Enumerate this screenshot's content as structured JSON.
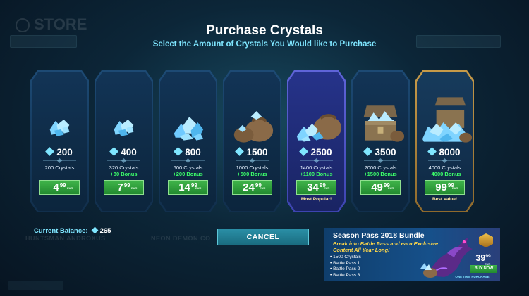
{
  "title": "Purchase Crystals",
  "subtitle": "Select the Amount of Crystals You Would like to Purchase",
  "background": {
    "store_label": "STORE",
    "name_left": "HUNTSMAN ANDROXUS",
    "name_center": "NEON DEMON CO"
  },
  "packs": [
    {
      "amount": "200",
      "crystals": "200 Crystals",
      "bonus": "",
      "price_main": "4",
      "price_cents": "99",
      "currency": "EUR",
      "tag": "",
      "variant": "normal",
      "art": "crystals-small"
    },
    {
      "amount": "400",
      "crystals": "320 Crystals",
      "bonus": "+80 Bonus",
      "price_main": "7",
      "price_cents": "99",
      "currency": "EUR",
      "tag": "",
      "variant": "normal",
      "art": "crystals-small"
    },
    {
      "amount": "800",
      "crystals": "600 Crystals",
      "bonus": "+200 Bonus",
      "price_main": "14",
      "price_cents": "99",
      "currency": "EUR",
      "tag": "",
      "variant": "normal",
      "art": "crystals-pile"
    },
    {
      "amount": "1500",
      "crystals": "1000 Crystals",
      "bonus": "+500 Bonus",
      "price_main": "24",
      "price_cents": "99",
      "currency": "EUR",
      "tag": "",
      "variant": "normal",
      "art": "crystal-sacks"
    },
    {
      "amount": "2500",
      "crystals": "1400 Crystals",
      "bonus": "+1100 Bonus",
      "price_main": "34",
      "price_cents": "99",
      "currency": "EUR",
      "tag": "Most Popular!",
      "variant": "popular",
      "art": "crystal-sack-spill"
    },
    {
      "amount": "3500",
      "crystals": "2000 Crystals",
      "bonus": "+1500 Bonus",
      "price_main": "49",
      "price_cents": "99",
      "currency": "EUR",
      "tag": "",
      "variant": "normal",
      "art": "crystal-chest"
    },
    {
      "amount": "8000",
      "crystals": "4000 Crystals",
      "bonus": "+4000 Bonus",
      "price_main": "99",
      "price_cents": "99",
      "currency": "EUR",
      "tag": "Best Value!",
      "variant": "best",
      "art": "crystal-chest-large"
    }
  ],
  "balance": {
    "label": "Current Balance:",
    "value": "265"
  },
  "cancel_label": "CANCEL",
  "season_pass": {
    "title": "Season Pass 2018 Bundle",
    "description": "Break into Battle Pass and earn Exclusive Content All Year Long!",
    "items": [
      "1500 Crystals",
      "Battle Pass 1",
      "Battle Pass 2",
      "Battle Pass 3"
    ],
    "price_main": "39",
    "price_cents": "99",
    "currency": "EUR",
    "buy_label": "BUY NOW",
    "note": "ONE TIME PURCHASE"
  },
  "colors": {
    "accent": "#7fe6ff",
    "bonus": "#3dff6a",
    "price_green": "#2fa33c",
    "popular": "#5f64d8",
    "best": "#c79a48"
  }
}
